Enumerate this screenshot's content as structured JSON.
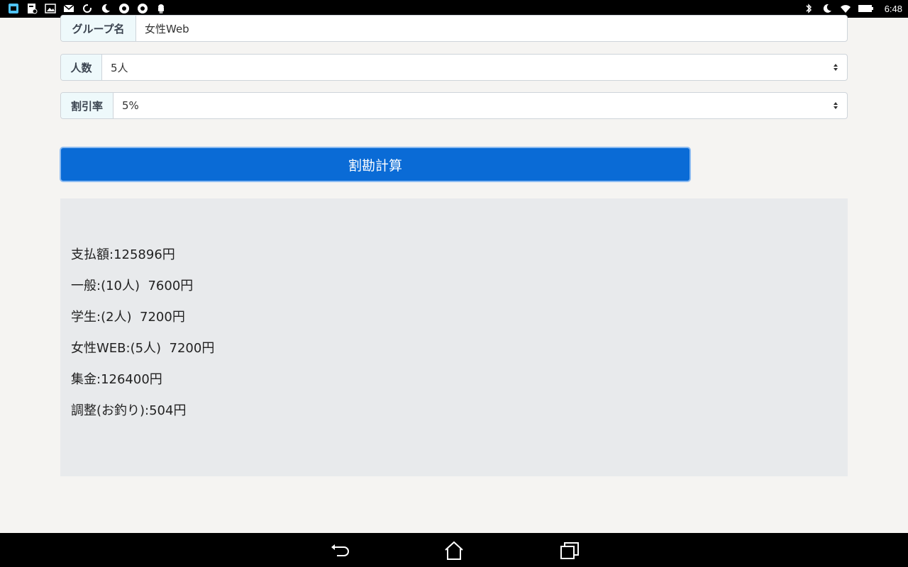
{
  "status_bar": {
    "time": "6:48",
    "left_icons": [
      "app-icon",
      "doc-icon",
      "gallery-icon",
      "mail-icon",
      "sync-icon",
      "moon-icon",
      "chrome-icon",
      "chrome-icon",
      "android-icon"
    ],
    "right_icons": [
      "bluetooth-icon",
      "moon-icon",
      "wifi-icon",
      "battery-icon"
    ]
  },
  "form": {
    "group_name": {
      "label": "グループ名",
      "value": "女性Web"
    },
    "people": {
      "label": "人数",
      "value": "5人"
    },
    "discount": {
      "label": "割引率",
      "value": "5%"
    }
  },
  "calc_button": {
    "label": "割勘計算"
  },
  "result": {
    "lines": [
      "支払額:125896円",
      "一般:(10人)  7600円",
      "学生:(2人)  7200円",
      "女性WEB:(5人)  7200円",
      "集金:126400円",
      "調整(お釣り):504円"
    ]
  },
  "colors": {
    "accent": "#0a6bd6",
    "label_bg": "#eef9fb",
    "result_bg": "#e8eaec",
    "page_bg": "#f5f4f2"
  }
}
